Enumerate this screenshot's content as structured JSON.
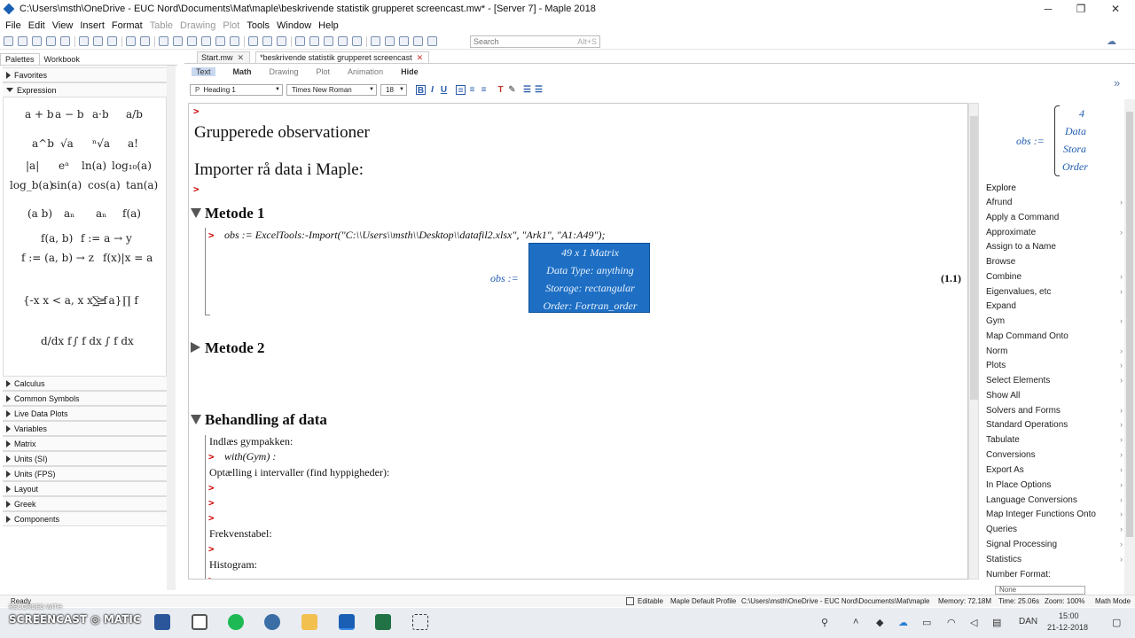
{
  "window": {
    "title": "C:\\Users\\msth\\OneDrive - EUC Nord\\Documents\\Mat\\maple\\beskrivende statistik grupperet screencast.mw* - [Server 7] - Maple 2018",
    "minimize": "─",
    "maximize": "❐",
    "close": "✕"
  },
  "menu": [
    "File",
    "Edit",
    "View",
    "Insert",
    "Format",
    "Table",
    "Drawing",
    "Plot",
    "Tools",
    "Window",
    "Help"
  ],
  "search": {
    "placeholder": "Search",
    "shortcut": "Alt+S"
  },
  "left_panel": {
    "tabs": [
      "Palettes",
      "Workbook"
    ],
    "favorites": "Favorites",
    "expression": "Expression",
    "expr_items": [
      "a + b",
      "a − b",
      "a·b",
      "a/b",
      "a^b",
      "√a",
      "ⁿ√a",
      "a!",
      "|a|",
      "eᵃ",
      "ln(a)",
      "log₁₀(a)",
      "log_b(a)",
      "sin(a)",
      "cos(a)",
      "tan(a)",
      "(a b)",
      "aₙ",
      "aₙ",
      "f(a)",
      "f(a, b)",
      "f := a → y",
      "f := (a, b) → z",
      "f(x)|x = a",
      "{-x x < a, x x ≥ a}",
      "∑ f",
      "∏ f",
      "d/dx f",
      "∫ f dx",
      "∫ f dx"
    ],
    "palettes": [
      "Calculus",
      "Common Symbols",
      "Live Data Plots",
      "Variables",
      "Matrix",
      "Units (SI)",
      "Units (FPS)",
      "Layout",
      "Greek",
      "Components"
    ]
  },
  "doc_tabs": [
    {
      "label": "Start.mw",
      "close": "✕"
    },
    {
      "label": "*beskrivende statistik grupperet screencast",
      "close": "✕"
    }
  ],
  "modes": [
    "Text",
    "Math",
    "Drawing",
    "Plot",
    "Animation",
    "Hide"
  ],
  "format": {
    "style": "Heading 1",
    "font": "Times New Roman",
    "size": "18"
  },
  "document": {
    "title1": "Grupperede observationer",
    "title2": "Importer rå data i Maple:",
    "section1": "Metode 1",
    "cmd1": "obs := ExcelTools:-Import(\"C:\\\\Users\\\\msth\\\\Desktop\\\\datafil2.xlsx\", \"Ark1\", \"A1:A49\");",
    "obs_label": "obs :=",
    "matrix_lines": [
      "49 x 1 Matrix",
      "Data Type: anything",
      "Storage: rectangular",
      "Order: Fortran_order"
    ],
    "eq_number": "(1.1)",
    "section2": "Metode 2",
    "section3": "Behandling af data",
    "text_load": "Indlæs gympakken:",
    "cmd_with": "with(Gym) :",
    "text_count": "Optælling i intervaller (find hyppigheder):",
    "text_freq": "Frekvenstabel:",
    "text_hist": "Histogram:"
  },
  "right_panel": {
    "preview_label": "obs :=",
    "preview_lines": [
      "4",
      "Data",
      "Stora",
      "Order"
    ],
    "explore": "Explore",
    "items": [
      {
        "label": "Afrund",
        "sub": true
      },
      {
        "label": "Apply a Command",
        "sub": false
      },
      {
        "label": "Approximate",
        "sub": true
      },
      {
        "label": "Assign to a Name",
        "sub": false
      },
      {
        "label": "Browse",
        "sub": false
      },
      {
        "label": "Combine",
        "sub": true
      },
      {
        "label": "Eigenvalues, etc",
        "sub": true
      },
      {
        "label": "Expand",
        "sub": false
      },
      {
        "label": "Gym",
        "sub": true
      },
      {
        "label": "Map Command Onto",
        "sub": false
      },
      {
        "label": "Norm",
        "sub": true
      },
      {
        "label": "Plots",
        "sub": true
      },
      {
        "label": "Select Elements",
        "sub": true
      },
      {
        "label": "Show All",
        "sub": false
      },
      {
        "label": "Solvers and Forms",
        "sub": true
      },
      {
        "label": "Standard Operations",
        "sub": true
      },
      {
        "label": "Tabulate",
        "sub": true
      },
      {
        "label": "Conversions",
        "sub": true
      },
      {
        "label": "Export As",
        "sub": true
      },
      {
        "label": "In Place Options",
        "sub": true
      },
      {
        "label": "Language Conversions",
        "sub": true
      },
      {
        "label": "Map Integer Functions Onto",
        "sub": true
      },
      {
        "label": "Queries",
        "sub": true
      },
      {
        "label": "Signal Processing",
        "sub": true
      },
      {
        "label": "Statistics",
        "sub": true
      }
    ],
    "number_format_label": "Number Format:",
    "number_format_value": "None"
  },
  "status": {
    "ready": "Ready",
    "editable": "Editable",
    "profile": "Maple Default Profile",
    "path": "C:\\Users\\msth\\OneDrive - EUC Nord\\Documents\\Mat\\maple",
    "memory": "Memory: 72.18M",
    "time": "Time: 25.06s",
    "zoom": "Zoom: 100%",
    "mode": "Math Mode"
  },
  "taskbar": {
    "watermark": "SCREENCAST ◎ MATIC",
    "recorded": "RECORDED WITH",
    "lang": "DAN",
    "clock_time": "15:00",
    "clock_date": "21-12-2018"
  }
}
